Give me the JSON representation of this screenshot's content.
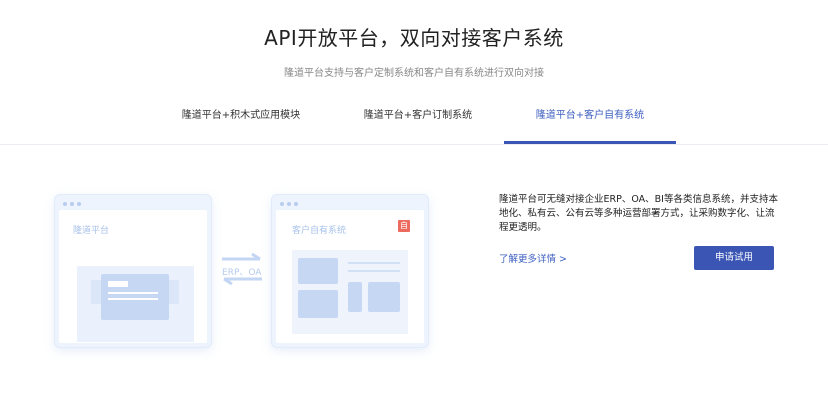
{
  "header": {
    "title": "API开放平台，双向对接客户系统",
    "subtitle": "隆道平台支持与客户定制系统和客户自有系统进行双向对接"
  },
  "tabs": [
    {
      "label": "隆道平台+积木式应用模块",
      "active": false
    },
    {
      "label": "隆道平台+客户订制系统",
      "active": false
    },
    {
      "label": "隆道平台+客户自有系统",
      "active": true
    }
  ],
  "illustration": {
    "left_window_label": "隆道平台",
    "right_window_label": "客户自有系统",
    "badge_text": "自",
    "exchange_label": "ERP、OA",
    "accent_color": "#3a55b4"
  },
  "content": {
    "description": "隆道平台可无缝对接企业ERP、OA、BI等各类信息系统，并支持本地化、私有云、公有云等多种运营部署方式，让采购数字化、让流程更透明。",
    "more_link": "了解更多详情 >",
    "try_button": "申请试用"
  }
}
